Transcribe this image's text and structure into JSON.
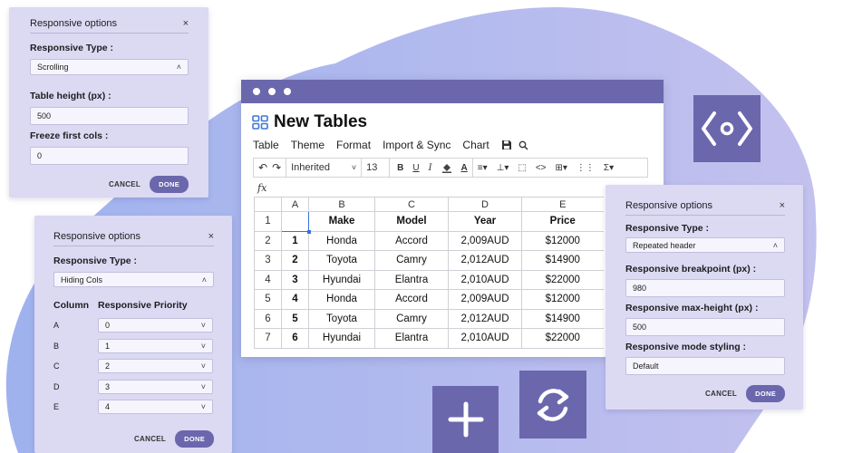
{
  "left_panel_1": {
    "title": "Responsive options",
    "close": "×",
    "type_label": "Responsive Type :",
    "type_value": "Scrolling",
    "height_label": "Table height (px) :",
    "height_value": "500",
    "freeze_label": "Freeze first cols :",
    "freeze_value": "0",
    "cancel": "CANCEL",
    "done": "DONE"
  },
  "left_panel_2": {
    "title": "Responsive options",
    "close": "×",
    "type_label": "Responsive Type :",
    "type_value": "Hiding Cols",
    "col_header": "Column",
    "priority_header": "Responsive Priority",
    "rows": [
      {
        "col": "A",
        "priority": "0"
      },
      {
        "col": "B",
        "priority": "1"
      },
      {
        "col": "C",
        "priority": "2"
      },
      {
        "col": "D",
        "priority": "3"
      },
      {
        "col": "E",
        "priority": "4"
      }
    ],
    "cancel": "CANCEL",
    "done": "DONE"
  },
  "right_panel": {
    "title": "Responsive options",
    "close": "×",
    "type_label": "Responsive Type :",
    "type_value": "Repeated header",
    "breakpoint_label": "Responsive breakpoint (px) :",
    "breakpoint_value": "980",
    "maxheight_label": "Responsive max-height (px) :",
    "maxheight_value": "500",
    "styling_label": "Responsive mode styling :",
    "styling_value": "Default",
    "cancel": "CANCEL",
    "done": "DONE"
  },
  "window": {
    "title": "New Tables",
    "menu": [
      "Table",
      "Theme",
      "Format",
      "Import & Sync",
      "Chart"
    ],
    "toolbar": {
      "font": "Inherited",
      "size": "13",
      "bold": "B",
      "underline": "U",
      "italic": "I",
      "sigma": "Σ"
    },
    "fx": "fx"
  },
  "sheet": {
    "columns": [
      "A",
      "B",
      "C",
      "D",
      "E"
    ],
    "header_row": {
      "num": "1",
      "cells": [
        "",
        "Make",
        "Model",
        "Year",
        "Price"
      ]
    },
    "rows": [
      {
        "num": "2",
        "cells": [
          "1",
          "Honda",
          "Accord",
          "2,009AUD",
          "$12000"
        ]
      },
      {
        "num": "3",
        "cells": [
          "2",
          "Toyota",
          "Camry",
          "2,012AUD",
          "$14900"
        ]
      },
      {
        "num": "4",
        "cells": [
          "3",
          "Hyundai",
          "Elantra",
          "2,010AUD",
          "$22000"
        ]
      },
      {
        "num": "5",
        "cells": [
          "4",
          "Honda",
          "Accord",
          "2,009AUD",
          "$12000"
        ]
      },
      {
        "num": "6",
        "cells": [
          "5",
          "Toyota",
          "Camry",
          "2,012AUD",
          "$14900"
        ]
      },
      {
        "num": "7",
        "cells": [
          "6",
          "Hyundai",
          "Elantra",
          "2,010AUD",
          "$22000"
        ]
      }
    ]
  },
  "colors": {
    "accent": "#6b67ad",
    "panel": "#dcd9f3",
    "blob": "#b6b9ec",
    "selection": "#3b6fd8"
  },
  "icons": {
    "embed": "code-embed-icon",
    "add": "plus-icon",
    "sync": "sync-icon",
    "tables": "grid-icon"
  }
}
